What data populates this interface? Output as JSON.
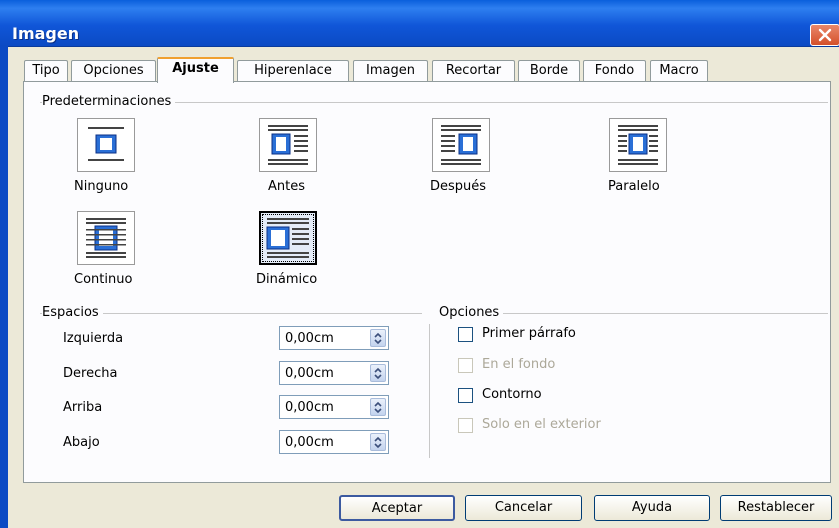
{
  "window": {
    "title": "Imagen"
  },
  "tabs": [
    {
      "label": "Tipo"
    },
    {
      "label": "Opciones"
    },
    {
      "label": "Ajuste"
    },
    {
      "label": "Hiperenlace"
    },
    {
      "label": "Imagen"
    },
    {
      "label": "Recortar"
    },
    {
      "label": "Borde"
    },
    {
      "label": "Fondo"
    },
    {
      "label": "Macro"
    }
  ],
  "active_tab": "Ajuste",
  "presets": {
    "group_label": "Predeterminaciones",
    "items": [
      {
        "label": "Ninguno",
        "icon": "wrap-none-icon"
      },
      {
        "label": "Antes",
        "icon": "wrap-before-icon"
      },
      {
        "label": "Después",
        "icon": "wrap-after-icon"
      },
      {
        "label": "Paralelo",
        "icon": "wrap-parallel-icon"
      },
      {
        "label": "Continuo",
        "icon": "wrap-through-icon"
      },
      {
        "label": "Dinámico",
        "icon": "wrap-optimal-icon",
        "selected": true
      }
    ]
  },
  "spacing": {
    "group_label": "Espacios",
    "fields": [
      {
        "label": "Izquierda",
        "value": "0,00cm"
      },
      {
        "label": "Derecha",
        "value": "0,00cm"
      },
      {
        "label": "Arriba",
        "value": "0,00cm"
      },
      {
        "label": "Abajo",
        "value": "0,00cm"
      }
    ]
  },
  "options": {
    "group_label": "Opciones",
    "items": [
      {
        "label": "Primer párrafo",
        "checked": false,
        "enabled": true
      },
      {
        "label": "En el fondo",
        "checked": false,
        "enabled": false
      },
      {
        "label": "Contorno",
        "checked": false,
        "enabled": true
      },
      {
        "label": "Solo en el exterior",
        "checked": false,
        "enabled": false
      }
    ]
  },
  "buttons": {
    "ok": "Aceptar",
    "cancel": "Cancelar",
    "help": "Ayuda",
    "reset": "Restablecer"
  },
  "colors": {
    "titlebar": "#0b4ac4",
    "dialog_bg": "#ece9d8",
    "panel_bg": "#fcfcfe",
    "active_tab_accent": "#f0a030",
    "close_button": "#d4502a"
  }
}
